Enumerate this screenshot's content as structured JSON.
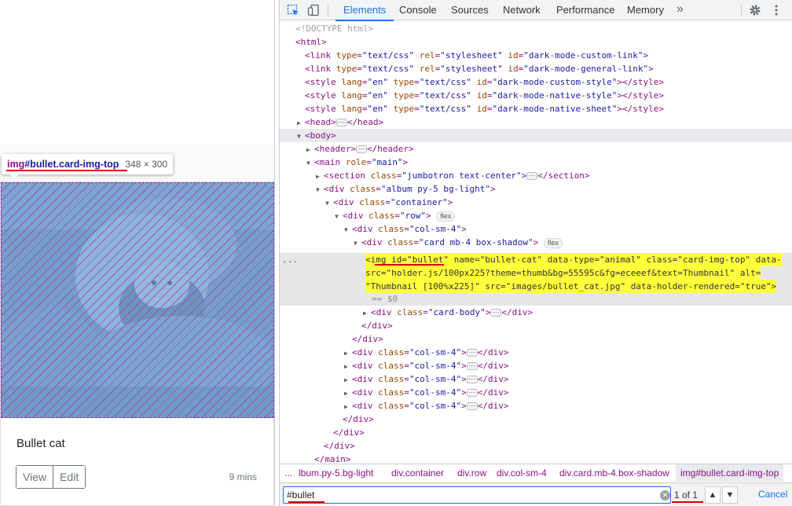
{
  "page": {
    "card_title": "Bullet cat",
    "view_label": "View",
    "edit_label": "Edit",
    "time": "9 mins"
  },
  "tooltip": {
    "tag": "img",
    "selector": "#bullet.card-img-top",
    "size": "348 × 300"
  },
  "devtools": {
    "tabs": [
      "Elements",
      "Console",
      "Sources",
      "Network",
      "Performance",
      "Memory"
    ],
    "active_tab": "Elements",
    "more": "»",
    "icons": [
      "inspect-icon",
      "device-toolbar-icon",
      "settings-icon",
      "more-options-icon"
    ],
    "dom": [
      {
        "indent": 0,
        "tri": "",
        "text": "<!DOCTYPE html>"
      },
      {
        "indent": 0,
        "tri": "",
        "text": "<html>"
      },
      {
        "indent": 1,
        "tri": "",
        "text": "<link type=\"text/css\" rel=\"stylesheet\" id=\"dark-mode-custom-link\">"
      },
      {
        "indent": 1,
        "tri": "",
        "text": "<link type=\"text/css\" rel=\"stylesheet\" id=\"dark-mode-general-link\">"
      },
      {
        "indent": 1,
        "tri": "",
        "text": "<style lang=\"en\" type=\"text/css\" id=\"dark-mode-custom-style\"></style>"
      },
      {
        "indent": 1,
        "tri": "",
        "text": "<style lang=\"en\" type=\"text/css\" id=\"dark-mode-native-style\"></style>"
      },
      {
        "indent": 1,
        "tri": "",
        "text": "<style lang=\"en\" type=\"text/css\" id=\"dark-mode-native-sheet\"></style>"
      },
      {
        "indent": 1,
        "tri": "▶",
        "text": "<head>",
        "dots": true,
        "after": "</head>"
      },
      {
        "indent": 1,
        "tri": "▼",
        "text": "<body>",
        "body": true
      },
      {
        "indent": 2,
        "tri": "▶",
        "text": "<header>",
        "dots": true,
        "after": "</header>"
      },
      {
        "indent": 2,
        "tri": "▼",
        "text": "<main role=\"main\">"
      },
      {
        "indent": 3,
        "tri": "▶",
        "text": "<section class=\"jumbotron text-center\">",
        "dots": true,
        "after": "</section>"
      },
      {
        "indent": 3,
        "tri": "▼",
        "text": "<div class=\"album py-5 bg-light\">"
      },
      {
        "indent": 4,
        "tri": "▼",
        "text": "<div class=\"container\">"
      },
      {
        "indent": 5,
        "tri": "▼",
        "text": "<div class=\"row\">",
        "pill": "flex"
      },
      {
        "indent": 6,
        "tri": "▼",
        "text": "<div class=\"col-sm-4\">"
      },
      {
        "indent": 7,
        "tri": "▼",
        "text": "<div class=\"card mb-4 box-shadow\">",
        "pill": "flex"
      }
    ],
    "selected": {
      "lines": [
        "<img id=\"bullet\" name=\"bullet-cat\" data-type=\"animal\" class=\"card-img-top\" data-",
        "src=\"holder.js/100px225?theme=thumb&bg=55595c&fg=eceeef&text=Thumbnail\" alt=",
        "\"Thumbnail [100%x225]\" src=\"images/bullet_cat.jpg\" data-holder-rendered=\"true\">"
      ],
      "eq": "== $0",
      "ellipsis": "..."
    },
    "dom_after": [
      {
        "indent": 8,
        "tri": "▶",
        "text": "<div class=\"card-body\">",
        "dots": true,
        "after": "</div>"
      },
      {
        "indent": 7,
        "tri": "",
        "text": "</div>"
      },
      {
        "indent": 6,
        "tri": "",
        "text": "</div>"
      },
      {
        "indent": 6,
        "tri": "▶",
        "text": "<div class=\"col-sm-4\">",
        "dots": true,
        "after": "</div>"
      },
      {
        "indent": 6,
        "tri": "▶",
        "text": "<div class=\"col-sm-4\">",
        "dots": true,
        "after": "</div>"
      },
      {
        "indent": 6,
        "tri": "▶",
        "text": "<div class=\"col-sm-4\">",
        "dots": true,
        "after": "</div>"
      },
      {
        "indent": 6,
        "tri": "▶",
        "text": "<div class=\"col-sm-4\">",
        "dots": true,
        "after": "</div>"
      },
      {
        "indent": 6,
        "tri": "▶",
        "text": "<div class=\"col-sm-4\">",
        "dots": true,
        "after": "</div>"
      },
      {
        "indent": 5,
        "tri": "",
        "text": "</div>"
      },
      {
        "indent": 4,
        "tri": "",
        "text": "</div>"
      },
      {
        "indent": 3,
        "tri": "",
        "text": "</div>"
      },
      {
        "indent": 2,
        "tri": "",
        "text": "</main>"
      }
    ],
    "breadcrumbs": [
      "...",
      "lbum.py-5.bg-light",
      "div.container",
      "div.row",
      "div.col-sm-4",
      "div.card.mb-4.box-shadow",
      "img#bullet.card-img-top"
    ],
    "search": {
      "value": "#bullet",
      "count": "1 of 1",
      "up": "▲",
      "down": "▼",
      "cancel": "Cancel"
    }
  }
}
